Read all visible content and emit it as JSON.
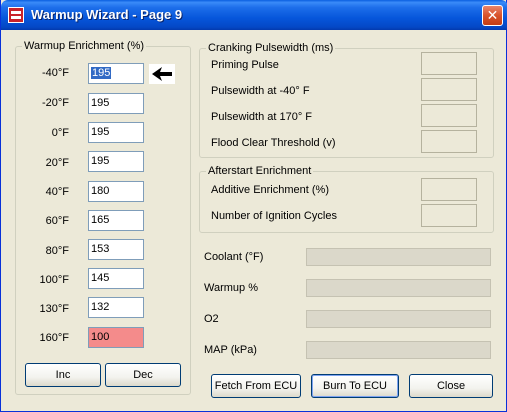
{
  "window": {
    "title": "Warmup Wizard - Page 9",
    "close_glyph": "✕"
  },
  "warmup": {
    "legend": "Warmup Enrichment (%)",
    "rows": [
      {
        "temp": "-40°F",
        "value": "195"
      },
      {
        "temp": "-20°F",
        "value": "195"
      },
      {
        "temp": "0°F",
        "value": "195"
      },
      {
        "temp": "20°F",
        "value": "195"
      },
      {
        "temp": "40°F",
        "value": "180"
      },
      {
        "temp": "60°F",
        "value": "165"
      },
      {
        "temp": "80°F",
        "value": "153"
      },
      {
        "temp": "100°F",
        "value": "145"
      },
      {
        "temp": "130°F",
        "value": "132"
      },
      {
        "temp": "160°F",
        "value": "100"
      }
    ],
    "inc_label": "Inc",
    "dec_label": "Dec",
    "current_row_icon": "arrow-left-icon",
    "highlight_color": "#F48B8B"
  },
  "cranking": {
    "legend": "Cranking Pulsewidth (ms)",
    "items": [
      "Priming Pulse",
      "Pulsewidth at -40° F",
      "Pulsewidth at  170° F",
      "Flood Clear Threshold (v)"
    ]
  },
  "afterstart": {
    "legend": "Afterstart Enrichment",
    "items": [
      "Additive Enrichment (%)",
      "Number of Ignition Cycles"
    ]
  },
  "gauges": [
    "Coolant (°F)",
    "Warmup %",
    "O2",
    "MAP (kPa)"
  ],
  "buttons": {
    "fetch": "Fetch From ECU",
    "burn": "Burn To ECU",
    "close": "Close"
  }
}
